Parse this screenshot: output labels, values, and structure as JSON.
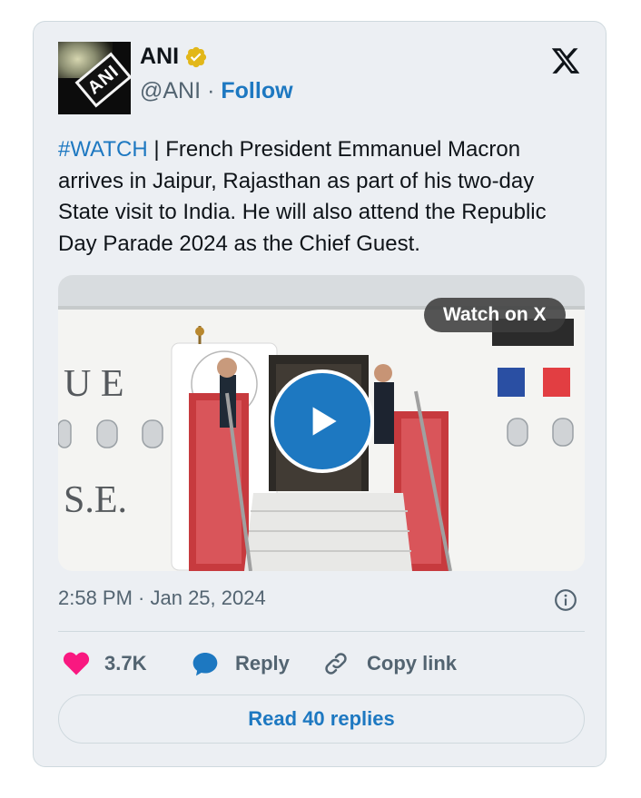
{
  "author": {
    "name": "ANI",
    "handle": "@ANI",
    "separator": "·",
    "follow_label": "Follow",
    "avatar_text": "ANI",
    "verified_icon": "verified-badge-icon"
  },
  "tweet": {
    "hashtag": "#WATCH",
    "body": " | French President Emmanuel Macron arrives in Jaipur, Rajasthan as part of his two-day State visit to India. He will also attend the Republic Day Parade 2024 as the Chief Guest."
  },
  "media": {
    "watch_label": "Watch on X",
    "fuselage_text_top": "U E",
    "fuselage_text_bottom": "S.E.",
    "play_icon": "play-icon"
  },
  "timestamp": "2:58 PM · Jan 25, 2024",
  "actions": {
    "like_count": "3.7K",
    "reply_label": "Reply",
    "copy_link_label": "Copy link"
  },
  "read_replies_label": "Read 40 replies",
  "colors": {
    "accent": "#1d78c1",
    "like": "#f91880",
    "card_bg": "#eceff3",
    "verified_gold": "#e2b719"
  }
}
